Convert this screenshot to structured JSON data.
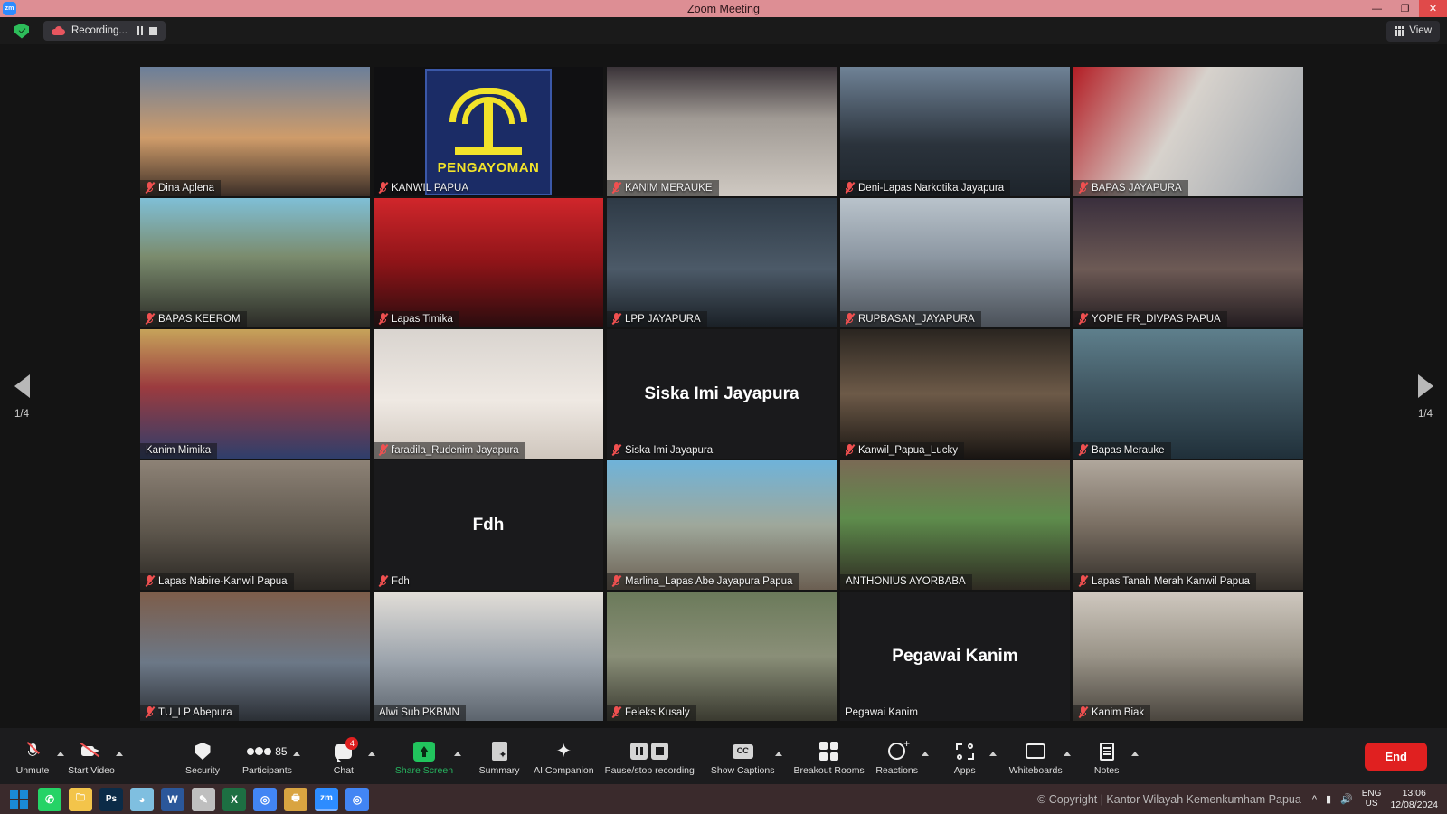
{
  "window": {
    "title": "Zoom Meeting",
    "app_logo": "zm",
    "controls": {
      "minimize": "—",
      "maximize": "❐",
      "close": "✕"
    }
  },
  "topbar": {
    "security_icon": "shield-check-icon",
    "recording_label": "Recording...",
    "pause_icon": "pause-icon",
    "stop_icon": "stop-icon",
    "view_label": "View",
    "view_icon": "grid-icon"
  },
  "gallery": {
    "page_left": "1/4",
    "page_right": "1/4",
    "prev_icon": "chevron-left-icon",
    "next_icon": "chevron-right-icon",
    "participants": [
      {
        "name": "Dina Aplena",
        "muted": true,
        "speaking": false,
        "kind": "video",
        "bg": "linear-gradient(180deg,#6b7f9a 0%,#cf9c6a 55%,#3b2e27 100%)"
      },
      {
        "name": "KANWIL PAPUA",
        "muted": true,
        "speaking": false,
        "kind": "logo",
        "bg": "#101012"
      },
      {
        "name": "KANIM MERAUKE",
        "muted": true,
        "speaking": false,
        "kind": "video",
        "bg": "linear-gradient(180deg,#3a3338 0%,#a09a94 40%,#cfc9c2 100%)"
      },
      {
        "name": "Deni-Lapas Narkotika Jayapura",
        "muted": true,
        "speaking": false,
        "kind": "video",
        "bg": "linear-gradient(180deg,#6f8296 0%,#2b333c 60%,#1d242b 100%)"
      },
      {
        "name": "BAPAS JAYAPURA",
        "muted": true,
        "speaking": false,
        "kind": "video",
        "bg": "linear-gradient(120deg,#b31e25 0%,#d7d2cc 45%,#9aa2ab 100%)"
      },
      {
        "name": "BAPAS KEEROM",
        "muted": true,
        "speaking": false,
        "kind": "video",
        "bg": "linear-gradient(180deg,#7fbfd6 0%,#7b8c6e 45%,#2a2a26 100%)"
      },
      {
        "name": "Lapas Timika",
        "muted": true,
        "speaking": false,
        "kind": "video",
        "bg": "linear-gradient(180deg,#d0262b 0%,#8e1418 50%,#2a0c0e 100%)"
      },
      {
        "name": "LPP JAYAPURA",
        "muted": true,
        "speaking": false,
        "kind": "video",
        "bg": "linear-gradient(180deg,#2e3a46 0%,#4c5a68 55%,#1a2026 100%)"
      },
      {
        "name": "RUPBASAN_JAYAPURA",
        "muted": true,
        "speaking": false,
        "kind": "video",
        "bg": "linear-gradient(180deg,#b9c3cb 0%,#8d98a3 45%,#4a5058 100%)"
      },
      {
        "name": "YOPIE FR_DIVPAS PAPUA",
        "muted": true,
        "speaking": false,
        "kind": "video",
        "bg": "linear-gradient(180deg,#3a2f3d 0%,#6d5a55 55%,#231c20 100%)"
      },
      {
        "name": "Kanim Mimika",
        "muted": false,
        "speaking": false,
        "kind": "video",
        "bg": "linear-gradient(180deg,#c6a35a 0%,#9b3b3f 45%,#2f3e6b 100%)"
      },
      {
        "name": "faradila_Rudenim Jayapura",
        "muted": true,
        "speaking": false,
        "kind": "video",
        "bg": "linear-gradient(180deg,#d9d4cf 0%,#efe9e3 55%,#cfc6bd 100%)"
      },
      {
        "name": "Siska Imi Jayapura",
        "muted": true,
        "speaking": false,
        "kind": "avatar",
        "bg": "#1a1a1c",
        "display": "Siska Imi Jayapura"
      },
      {
        "name": "Kanwil_Papua_Lucky",
        "muted": true,
        "speaking": false,
        "kind": "video",
        "bg": "linear-gradient(180deg,#2a2520 0%,#6d5a48 50%,#191512 100%)"
      },
      {
        "name": "Bapas Merauke",
        "muted": true,
        "speaking": false,
        "kind": "video",
        "bg": "linear-gradient(180deg,#5e7f8c 0%,#3f5560 50%,#20303a 100%)"
      },
      {
        "name": "Lapas Nabire-Kanwil Papua",
        "muted": true,
        "speaking": false,
        "kind": "video",
        "bg": "linear-gradient(180deg,#8d8276 0%,#5d564c 55%,#2a2723 100%)"
      },
      {
        "name": "Fdh",
        "muted": true,
        "speaking": false,
        "kind": "avatar",
        "bg": "#1a1a1c",
        "display": "Fdh"
      },
      {
        "name": "Marlina_Lapas Abe Jayapura Papua",
        "muted": true,
        "speaking": false,
        "kind": "video",
        "bg": "linear-gradient(180deg,#6fb3d9 0%,#9fa89b 50%,#6b5f52 100%)"
      },
      {
        "name": "ANTHONIUS AYORBABA",
        "muted": false,
        "speaking": true,
        "kind": "video",
        "bg": "linear-gradient(180deg,#7a6a55 0%,#5e8c4c 45%,#2e2a22 100%)"
      },
      {
        "name": "Lapas Tanah Merah Kanwil Papua",
        "muted": true,
        "speaking": false,
        "kind": "video",
        "bg": "linear-gradient(180deg,#b0a79c 0%,#7a6f63 50%,#332e29 100%)"
      },
      {
        "name": "TU_LP Abepura",
        "muted": true,
        "speaking": false,
        "kind": "video",
        "bg": "linear-gradient(180deg,#7d5d4a 0%,#6c7887 55%,#2b2f35 100%)"
      },
      {
        "name": "Alwi Sub PKBMN",
        "muted": false,
        "speaking": false,
        "kind": "video",
        "bg": "linear-gradient(180deg,#e2ded8 0%,#9aa2ab 55%,#5c646d 100%)"
      },
      {
        "name": "Feleks Kusaly",
        "muted": true,
        "speaking": false,
        "kind": "video",
        "bg": "linear-gradient(180deg,#6b7a5a 0%,#8a8f78 50%,#3a3a30 100%)"
      },
      {
        "name": "Pegawai Kanim",
        "muted": false,
        "speaking": false,
        "kind": "avatar",
        "bg": "#1a1a1c",
        "display": "Pegawai Kanim"
      },
      {
        "name": "Kanim Biak",
        "muted": true,
        "speaking": false,
        "kind": "video",
        "bg": "linear-gradient(180deg,#cfc8bf 0%,#9a9488 50%,#4a453e 100%)"
      }
    ],
    "logo_tile": {
      "text": "PENGAYOMAN",
      "bg": "#1b2c66",
      "fg": "#f2e32a"
    }
  },
  "toolbar": {
    "items": [
      {
        "label": "Unmute",
        "icon": "microphone-muted-icon",
        "caret": true,
        "state": "muted"
      },
      {
        "label": "Start Video",
        "icon": "camera-muted-icon",
        "caret": true,
        "state": "muted"
      },
      {
        "label": "Security",
        "icon": "shield-icon",
        "caret": false
      },
      {
        "label": "Participants",
        "icon": "participants-icon",
        "caret": true,
        "count": "85"
      },
      {
        "label": "Chat",
        "icon": "chat-icon",
        "caret": true,
        "badge": "4"
      },
      {
        "label": "Share Screen",
        "icon": "share-screen-icon",
        "caret": true,
        "accent": true
      },
      {
        "label": "Summary",
        "icon": "summary-doc-icon",
        "caret": false
      },
      {
        "label": "AI Companion",
        "icon": "ai-sparkle-icon",
        "caret": false
      },
      {
        "label": "Pause/stop recording",
        "icon": "pause-stop-recording-icon",
        "caret": false
      },
      {
        "label": "Show Captions",
        "icon": "closed-captions-icon",
        "caret": true
      },
      {
        "label": "Breakout Rooms",
        "icon": "breakout-rooms-icon",
        "caret": false
      },
      {
        "label": "Reactions",
        "icon": "reactions-icon",
        "caret": true
      },
      {
        "label": "Apps",
        "icon": "apps-icon",
        "caret": true
      },
      {
        "label": "Whiteboards",
        "icon": "whiteboard-icon",
        "caret": true
      },
      {
        "label": "Notes",
        "icon": "notes-icon",
        "caret": true
      }
    ],
    "end_label": "End"
  },
  "taskbar": {
    "apps": [
      {
        "name": "start-button",
        "glyph": "",
        "color": "#1a8ad6"
      },
      {
        "name": "whatsapp",
        "glyph": "✆",
        "color": "#25d366"
      },
      {
        "name": "file-explorer",
        "glyph": "🗀",
        "color": "#f3c44a"
      },
      {
        "name": "photoshop",
        "glyph": "Ps",
        "color": "#0b2b47"
      },
      {
        "name": "media-player",
        "glyph": "◕",
        "color": "#7fbfe0"
      },
      {
        "name": "word",
        "glyph": "W",
        "color": "#2b579a"
      },
      {
        "name": "pen-tool",
        "glyph": "✎",
        "color": "#bfbfbf"
      },
      {
        "name": "excel",
        "glyph": "X",
        "color": "#1d6f42"
      },
      {
        "name": "chrome",
        "glyph": "◎",
        "color": "#4285f4"
      },
      {
        "name": "printer",
        "glyph": "🖶",
        "color": "#d9a441"
      },
      {
        "name": "zoom",
        "glyph": "zm",
        "color": "#2d8cff"
      },
      {
        "name": "chrome-window",
        "glyph": "◎",
        "color": "#4285f4"
      }
    ],
    "watermark": "© Copyright | Kantor Wilayah Kemenkumham Papua",
    "language": "ENG",
    "language_sub": "US",
    "time": "13:06",
    "date": "12/08/2024"
  }
}
